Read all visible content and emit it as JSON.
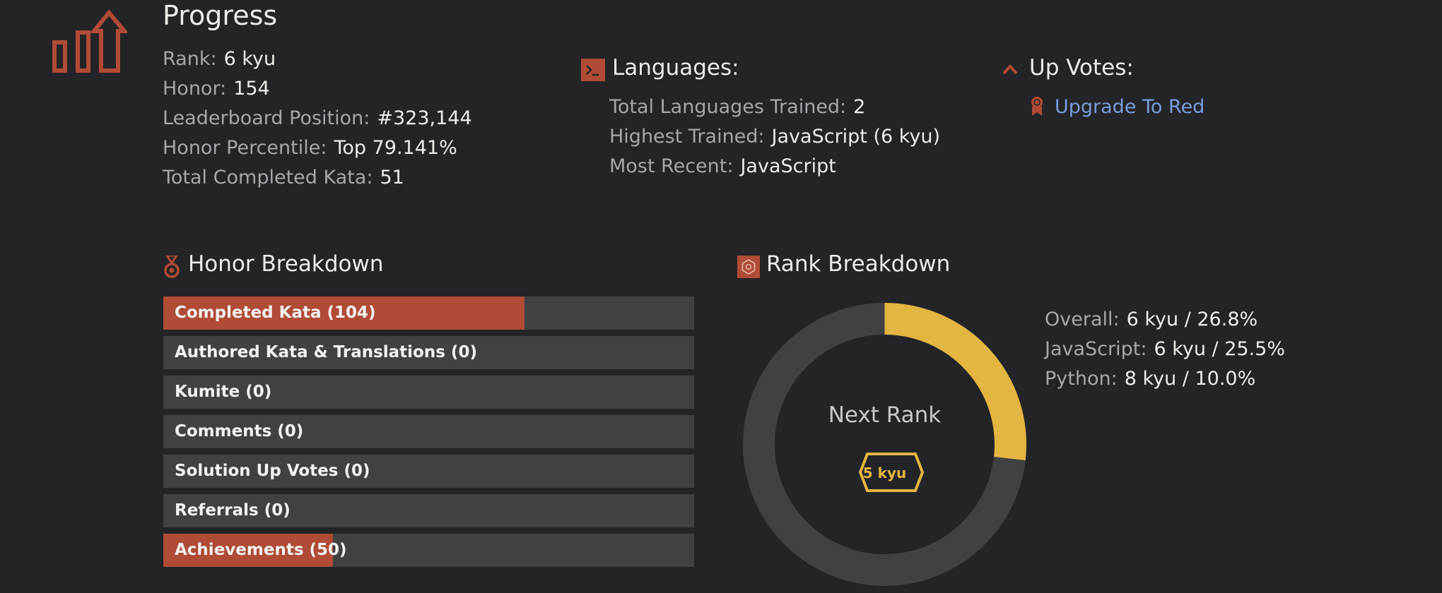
{
  "progress": {
    "title": "Progress",
    "stats": [
      {
        "label": "Rank:",
        "value": "6 kyu"
      },
      {
        "label": "Honor:",
        "value": "154"
      },
      {
        "label": "Leaderboard Position:",
        "value": "#323,144"
      },
      {
        "label": "Honor Percentile:",
        "value": "Top 79.141%"
      },
      {
        "label": "Total Completed Kata:",
        "value": "51"
      }
    ]
  },
  "languages": {
    "title": "Languages:",
    "stats": [
      {
        "label": "Total Languages Trained:",
        "value": "2"
      },
      {
        "label": "Highest Trained:",
        "value": "JavaScript (6 kyu)"
      },
      {
        "label": "Most Recent:",
        "value": "JavaScript"
      }
    ]
  },
  "upvotes": {
    "title": "Up Votes:",
    "link": "Upgrade To Red"
  },
  "honor_breakdown": {
    "title": "Honor Breakdown",
    "bars": [
      {
        "label": "Completed Kata (104)",
        "fill": 0.68
      },
      {
        "label": "Authored Kata & Translations (0)",
        "fill": 0
      },
      {
        "label": "Kumite (0)",
        "fill": 0
      },
      {
        "label": "Comments (0)",
        "fill": 0
      },
      {
        "label": "Solution Up Votes (0)",
        "fill": 0
      },
      {
        "label": "Referrals (0)",
        "fill": 0
      },
      {
        "label": "Achievements (50)",
        "fill": 0.32
      }
    ]
  },
  "rank_breakdown": {
    "title": "Rank Breakdown",
    "next_rank_label": "Next Rank",
    "next_rank_badge": "5 kyu",
    "progress_fraction": 0.268,
    "stats": [
      {
        "label": "Overall:",
        "value": "6 kyu / 26.8%"
      },
      {
        "label": "JavaScript:",
        "value": "6 kyu / 25.5%"
      },
      {
        "label": "Python:",
        "value": "8 kyu / 10.0%"
      }
    ]
  },
  "colors": {
    "background": "#232427",
    "accent_red": "#b04b35",
    "rank_yellow": "#e3b541",
    "track_gray": "#404143",
    "link_blue": "#7a9ddc"
  },
  "icons": {
    "progress": "bar-chart-up-arrow-icon",
    "languages": "terminal-icon",
    "upvotes": "chevron-up-icon",
    "upgrade": "ribbon-award-icon",
    "honor": "medal-icon",
    "rank": "hexagon-badge-icon"
  }
}
